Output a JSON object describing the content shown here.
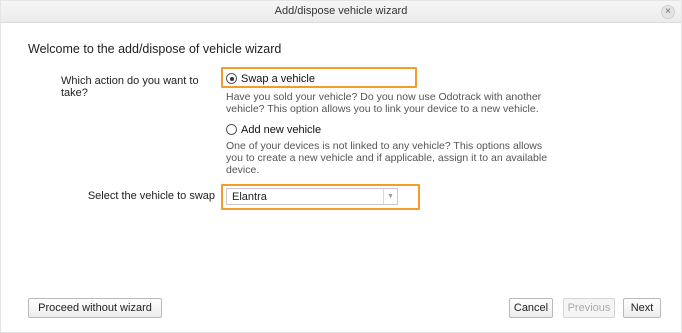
{
  "dialog": {
    "title": "Add/dispose vehicle wizard",
    "close_glyph": "×",
    "heading": "Welcome to the add/dispose of vehicle wizard"
  },
  "action": {
    "question": "Which action do you want to take?",
    "options": [
      {
        "label": "Swap a vehicle",
        "selected": true,
        "description_lines": [
          "Have you sold your vehicle? Do you now use Odotrack with another",
          "vehicle? This option allows you to link your device to a new vehicle."
        ]
      },
      {
        "label": "Add new vehicle",
        "selected": false,
        "description_lines": [
          "One of your devices is not linked to any vehicle? This options allows",
          "you to create a new vehicle and if applicable, assign it to an available",
          "device."
        ]
      }
    ]
  },
  "swap": {
    "label": "Select the vehicle to swap",
    "selected_value": "Elantra",
    "arrow_icon": "chevron-down-icon"
  },
  "buttons": {
    "proceed": "Proceed without wizard",
    "cancel": "Cancel",
    "previous": "Previous",
    "next": "Next"
  },
  "colors": {
    "highlight": "#f39c2a"
  }
}
